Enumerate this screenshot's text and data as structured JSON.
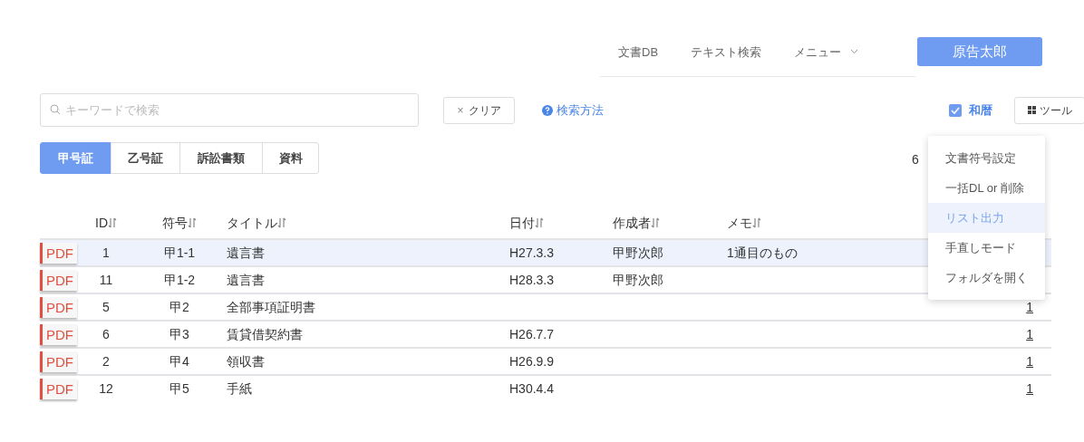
{
  "nav": {
    "items": [
      "文書DB",
      "テキスト検索",
      "メニュー"
    ],
    "user_button": "原告太郎"
  },
  "search": {
    "placeholder": "キーワードで検索"
  },
  "clear_button": "クリア",
  "clear_icon": "×",
  "help_link": "検索方法",
  "wareki": {
    "label": "和暦",
    "checked": true
  },
  "tool_button": "ツール",
  "tool_menu": [
    {
      "label": "文書符号設定",
      "highlighted": false
    },
    {
      "label": "一括DL or 削除",
      "highlighted": false
    },
    {
      "label": "リスト出力",
      "highlighted": true
    },
    {
      "label": "手直しモード",
      "highlighted": false
    },
    {
      "label": "フォルダを開く",
      "highlighted": false
    }
  ],
  "tabs": [
    {
      "label": "甲号証",
      "selected": true
    },
    {
      "label": "乙号証",
      "selected": false
    },
    {
      "label": "訴訟書類",
      "selected": false
    },
    {
      "label": "資料",
      "selected": false
    }
  ],
  "count": "6",
  "table": {
    "columns": [
      "ID",
      "符号",
      "タイトル",
      "日付",
      "作成者",
      "メモ"
    ],
    "rows": [
      {
        "badge": "PDF",
        "cells": [
          "1",
          "甲1-1",
          "遺言書",
          "H27.3.3",
          "甲野次郎",
          "1通目のもの"
        ],
        "selected": true
      },
      {
        "badge": "PDF",
        "cells": [
          "11",
          "甲1-2",
          "遺言書",
          "H28.3.3",
          "甲野次郎",
          ""
        ],
        "selected": false
      },
      {
        "badge": "PDF",
        "cells": [
          "5",
          "甲2",
          "全部事項証明書",
          "",
          "",
          ""
        ],
        "link": "1",
        "selected": false
      },
      {
        "badge": "PDF",
        "cells": [
          "6",
          "甲3",
          "賃貸借契約書",
          "H26.7.7",
          "",
          ""
        ],
        "link": "1",
        "selected": false
      },
      {
        "badge": "PDF",
        "cells": [
          "2",
          "甲4",
          "領収書",
          "H26.9.9",
          "",
          ""
        ],
        "link": "1",
        "selected": false
      },
      {
        "badge": "PDF",
        "cells": [
          "12",
          "甲5",
          "手紙",
          "H30.4.4",
          "",
          ""
        ],
        "link": "1",
        "selected": false
      }
    ]
  }
}
